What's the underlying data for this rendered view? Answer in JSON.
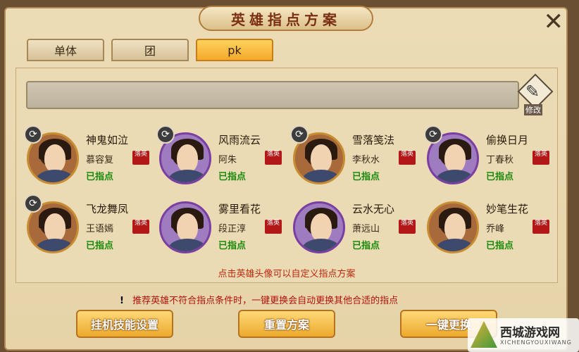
{
  "window": {
    "title": "英雄指点方案",
    "close_label": "✕"
  },
  "tabs": [
    {
      "label": "单体",
      "active": false
    },
    {
      "label": "团",
      "active": false
    },
    {
      "label": "pk",
      "active": true
    }
  ],
  "input_bar": {
    "value": ""
  },
  "edit_button": {
    "label": "修改"
  },
  "heroes": [
    {
      "name": "神鬼如泣",
      "tag": "慕容复",
      "status": "已指点",
      "seal": "落英",
      "frame": "gold"
    },
    {
      "name": "风雨流云",
      "tag": "阿朱",
      "status": "已指点",
      "seal": "落英",
      "frame": "purple"
    },
    {
      "name": "雪落笺法",
      "tag": "李秋水",
      "status": "已指点",
      "seal": "落英",
      "frame": "gold"
    },
    {
      "name": "偷换日月",
      "tag": "丁春秋",
      "status": "已指点",
      "seal": "落英",
      "frame": "purple"
    },
    {
      "name": "飞龙舞凤",
      "tag": "王语嫣",
      "status": "已指点",
      "seal": "落英",
      "frame": "gold"
    },
    {
      "name": "雾里看花",
      "tag": "段正淳",
      "status": "已指点",
      "seal": "落英",
      "frame": "purple"
    },
    {
      "name": "云水无心",
      "tag": "萧远山",
      "status": "已指点",
      "seal": "落英",
      "frame": "purple"
    },
    {
      "name": "妙笔生花",
      "tag": "乔峰",
      "status": "已指点",
      "seal": "落英",
      "frame": "gold"
    }
  ],
  "hint": "点击英雄头像可以自定义指点方案",
  "warning": {
    "bang": "!",
    "text": "推荐英雄不符合指点条件时，一键更换会自动更换其他合适的指点"
  },
  "buttons": {
    "idle_skill": "挂机技能设置",
    "reset": "重置方案",
    "one_key": "一键更换"
  },
  "watermark": {
    "title": "西城游戏网",
    "subtitle": "XICHENGYOUXIWANG"
  },
  "colors": {
    "accent": "#f3a92c",
    "status_green": "#1a8a0a",
    "warning_red": "#b5120d"
  }
}
